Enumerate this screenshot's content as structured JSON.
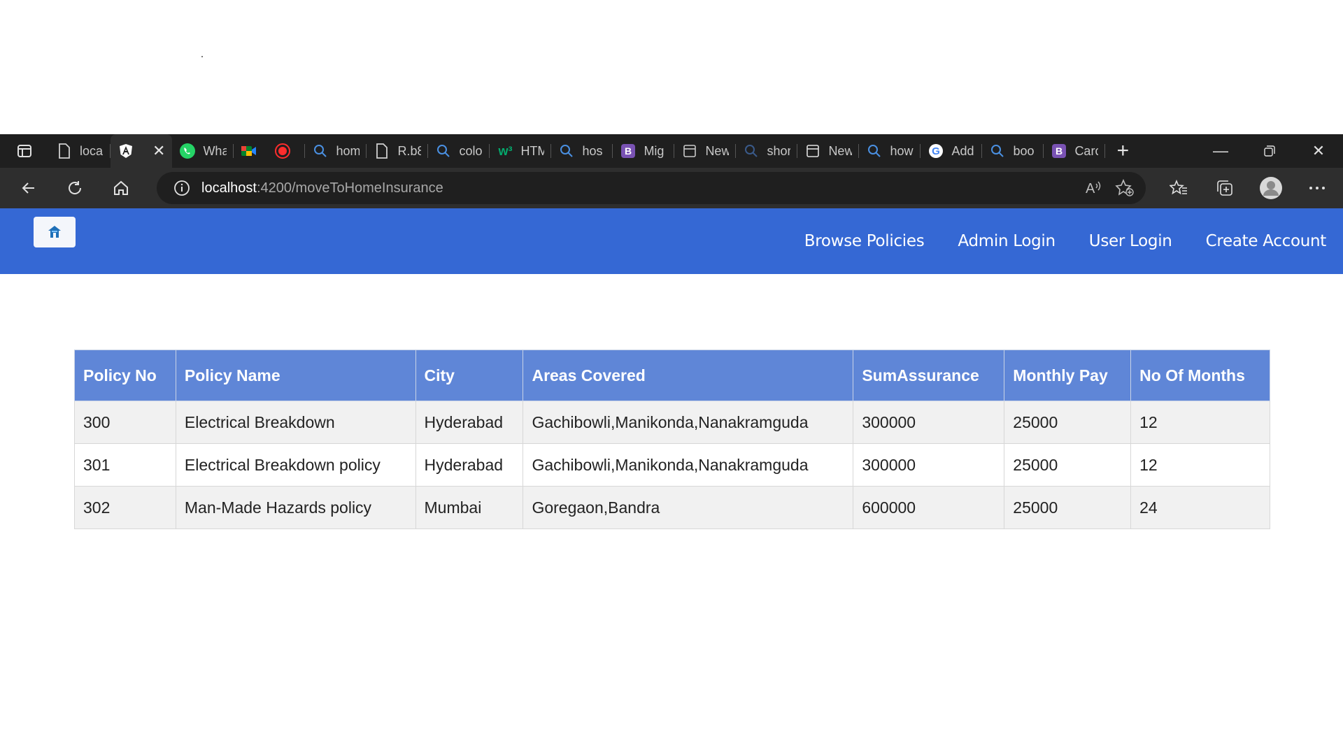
{
  "browser": {
    "tabs": [
      {
        "label": "loca",
        "icon": "page-icon",
        "active": false
      },
      {
        "label": "",
        "icon": "angular-icon",
        "active": true
      },
      {
        "label": "Wha",
        "icon": "whatsapp-icon",
        "active": false
      },
      {
        "label": "",
        "icon": "meet-icon",
        "active": false
      },
      {
        "label": "hom",
        "icon": "search-icon",
        "active": false
      },
      {
        "label": "R.b8",
        "icon": "page-icon",
        "active": false
      },
      {
        "label": "colo",
        "icon": "search-icon",
        "active": false
      },
      {
        "label": "HTM",
        "icon": "w3-icon",
        "active": false
      },
      {
        "label": "hos",
        "icon": "search-icon",
        "active": false
      },
      {
        "label": "Mig",
        "icon": "bootstrap-icon",
        "active": false
      },
      {
        "label": "New",
        "icon": "newtab-icon",
        "active": false
      },
      {
        "label": "shor",
        "icon": "search-icon",
        "active": false
      },
      {
        "label": "New",
        "icon": "newtab-icon",
        "active": false
      },
      {
        "label": "how",
        "icon": "search-icon",
        "active": false
      },
      {
        "label": "Add",
        "icon": "google-icon",
        "active": false
      },
      {
        "label": "boo",
        "icon": "search-icon",
        "active": false
      },
      {
        "label": "Carc",
        "icon": "bootstrap-icon",
        "active": false
      }
    ],
    "url_host": "localhost",
    "url_path": ":4200/moveToHomeInsurance"
  },
  "header": {
    "nav": [
      "Browse Policies",
      "Admin Login",
      "User Login",
      "Create Account"
    ]
  },
  "table": {
    "columns": [
      "Policy No",
      "Policy Name",
      "City",
      "Areas Covered",
      "SumAssurance",
      "Monthly Pay",
      "No Of Months"
    ],
    "rows": [
      [
        "300",
        "Electrical Breakdown",
        "Hyderabad",
        "Gachibowli,Manikonda,Nanakramguda",
        "300000",
        "25000",
        "12"
      ],
      [
        "301",
        "Electrical Breakdown policy",
        "Hyderabad",
        "Gachibowli,Manikonda,Nanakramguda",
        "300000",
        "25000",
        "12"
      ],
      [
        "302",
        "Man-Made Hazards policy",
        "Mumbai",
        "Goregaon,Bandra",
        "600000",
        "25000",
        "24"
      ]
    ]
  },
  "colors": {
    "header_bg": "#3568d4",
    "table_header_bg": "#5f86d7"
  }
}
